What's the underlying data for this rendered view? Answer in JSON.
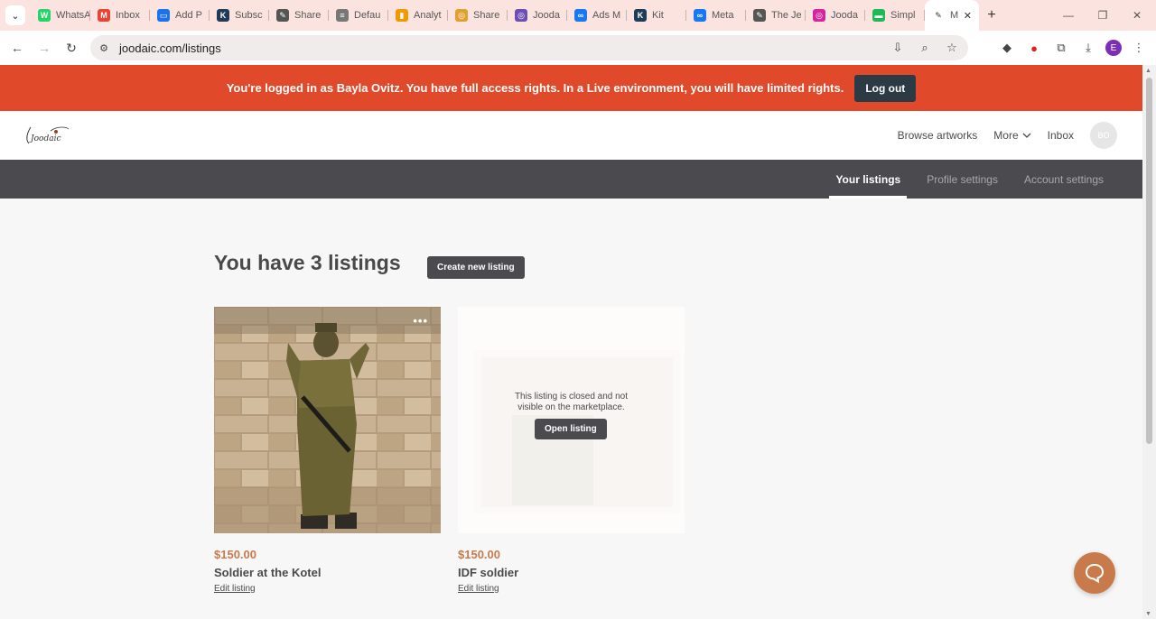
{
  "browser": {
    "tabs": [
      {
        "label": "WhatsApp",
        "color": "#25d366",
        "glyph": "W"
      },
      {
        "label": "Inbox",
        "color": "#ea4335",
        "glyph": "M"
      },
      {
        "label": "Add P",
        "color": "#1a73e8",
        "glyph": "▭"
      },
      {
        "label": "Subsc",
        "color": "#1f3b57",
        "glyph": "K"
      },
      {
        "label": "Share",
        "color": "#555555",
        "glyph": "✎"
      },
      {
        "label": "Defau",
        "color": "#777777",
        "glyph": "≡"
      },
      {
        "label": "Analyt",
        "color": "#f29900",
        "glyph": "▮"
      },
      {
        "label": "Share",
        "color": "#e0a030",
        "glyph": "◎"
      },
      {
        "label": "Jooda",
        "color": "#6b4fb5",
        "glyph": "◎"
      },
      {
        "label": "Ads M",
        "color": "#1877f2",
        "glyph": "∞"
      },
      {
        "label": "Kit",
        "color": "#1f3b57",
        "glyph": "K"
      },
      {
        "label": "Meta",
        "color": "#1877f2",
        "glyph": "∞"
      },
      {
        "label": "The Je",
        "color": "#555555",
        "glyph": "✎"
      },
      {
        "label": "Jooda",
        "color": "#d6249f",
        "glyph": "◎"
      },
      {
        "label": "Simpl",
        "color": "#1db954",
        "glyph": "▬"
      }
    ],
    "active_tab": {
      "label": "M",
      "glyph": "✎"
    },
    "url": "joodaic.com/listings",
    "profile_initial": "E"
  },
  "banner": {
    "text": "You're logged in as Bayla Ovitz. You have full access rights. In a Live environment, you will have limited rights.",
    "logout_label": "Log out"
  },
  "topnav": {
    "logo_text": "Joodaic",
    "browse_label": "Browse artworks",
    "more_label": "More",
    "inbox_label": "Inbox",
    "avatar_initials": "BO"
  },
  "subnav": {
    "tabs": [
      "Your listings",
      "Profile settings",
      "Account settings"
    ]
  },
  "main": {
    "heading": "You have 3 listings",
    "create_label": "Create new listing"
  },
  "listings": [
    {
      "price": "$150.00",
      "title": "Soldier at the Kotel",
      "edit_label": "Edit listing",
      "menu": "•••"
    },
    {
      "price": "$150.00",
      "title": "IDF soldier",
      "edit_label": "Edit listing",
      "closed_text_1": "This listing is closed and not",
      "closed_text_2": "visible on the marketplace.",
      "open_label": "Open listing"
    }
  ],
  "colors": {
    "banner": "#e0492a",
    "accent": "#c97a4b",
    "subnav": "#4a4a4f"
  }
}
